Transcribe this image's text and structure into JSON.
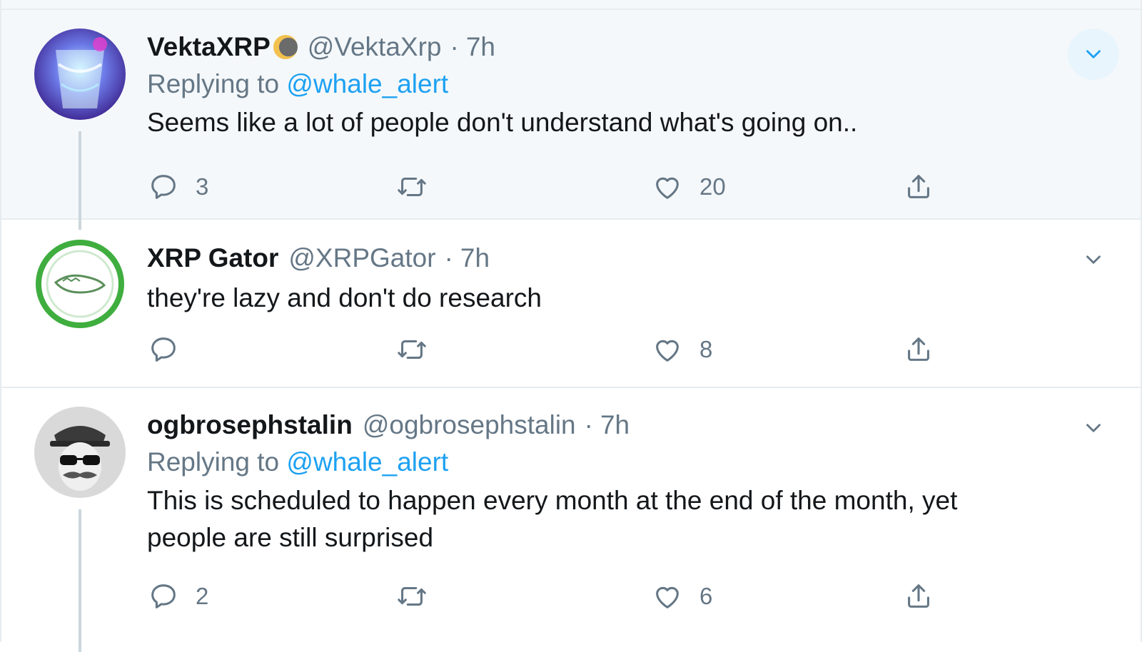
{
  "colors": {
    "accent": "#1da1f2",
    "muted": "#657786",
    "text": "#14171a",
    "hover_bg": "#f5f8fa",
    "border": "#e6ecf0"
  },
  "tweets": [
    {
      "display_name": "VektaXRP",
      "has_badge": true,
      "badge_icon": "half-moon-emoji",
      "handle": "@VektaXrp",
      "separator": "·",
      "time": "7h",
      "replying_label": "Replying to",
      "replying_to": "@whale_alert",
      "text": "Seems like a lot of people don't understand what's going on..",
      "reply_count": "3",
      "retweet_count": "",
      "like_count": "20",
      "avatar_icon": "glowing-cup-avatar"
    },
    {
      "display_name": "XRP Gator",
      "has_badge": false,
      "handle": "@XRPGator",
      "separator": "·",
      "time": "7h",
      "text": "they're lazy and don't do research",
      "reply_count": "",
      "retweet_count": "",
      "like_count": "8",
      "avatar_icon": "gator-logo-avatar"
    },
    {
      "display_name": "ogbrosephstalin",
      "has_badge": false,
      "handle": "@ogbrosephstalin",
      "separator": "·",
      "time": "7h",
      "replying_label": "Replying to",
      "replying_to": "@whale_alert",
      "text_line1": "This is scheduled to happen every month at the end of the month, yet",
      "text_line2": "people are still surprised",
      "reply_count": "2",
      "retweet_count": "",
      "like_count": "6",
      "avatar_icon": "mustache-man-avatar"
    }
  ]
}
